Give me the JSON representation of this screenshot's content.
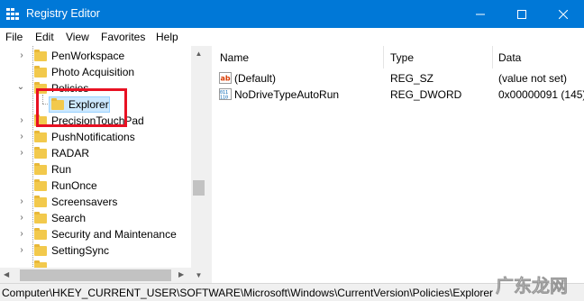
{
  "window": {
    "title": "Registry Editor",
    "accent_color": "#0078d7",
    "title_icon": "registry-icon"
  },
  "menu": [
    {
      "label": "File"
    },
    {
      "label": "Edit"
    },
    {
      "label": "View"
    },
    {
      "label": "Favorites"
    },
    {
      "label": "Help"
    }
  ],
  "tree": {
    "items": [
      {
        "label": "PenWorkspace",
        "expander": "collapsed"
      },
      {
        "label": "Photo Acquisition",
        "expander": "none"
      },
      {
        "label": "Policies",
        "expander": "expanded"
      },
      {
        "label": "Explorer",
        "expander": "none",
        "selected": true
      },
      {
        "label": "PrecisionTouchPad",
        "expander": "collapsed"
      },
      {
        "label": "PushNotifications",
        "expander": "collapsed"
      },
      {
        "label": "RADAR",
        "expander": "collapsed"
      },
      {
        "label": "Run",
        "expander": "none"
      },
      {
        "label": "RunOnce",
        "expander": "none"
      },
      {
        "label": "Screensavers",
        "expander": "collapsed"
      },
      {
        "label": "Search",
        "expander": "collapsed"
      },
      {
        "label": "Security and Maintenance",
        "expander": "collapsed"
      },
      {
        "label": "SettingSync",
        "expander": "collapsed"
      }
    ],
    "highlight_color": "#e81123"
  },
  "list": {
    "columns": [
      "Name",
      "Type",
      "Data"
    ],
    "rows": [
      {
        "name": "(Default)",
        "type": "REG_SZ",
        "data": "(value not set)",
        "icon": "string-value-icon"
      },
      {
        "name": "NoDriveTypeAutoRun",
        "type": "REG_DWORD",
        "data": "0x00000091 (145)",
        "icon": "binary-value-icon"
      }
    ]
  },
  "status": {
    "path": "Computer\\HKEY_CURRENT_USER\\SOFTWARE\\Microsoft\\Windows\\CurrentVersion\\Policies\\Explorer"
  },
  "watermark": {
    "text": "广东龙网"
  }
}
